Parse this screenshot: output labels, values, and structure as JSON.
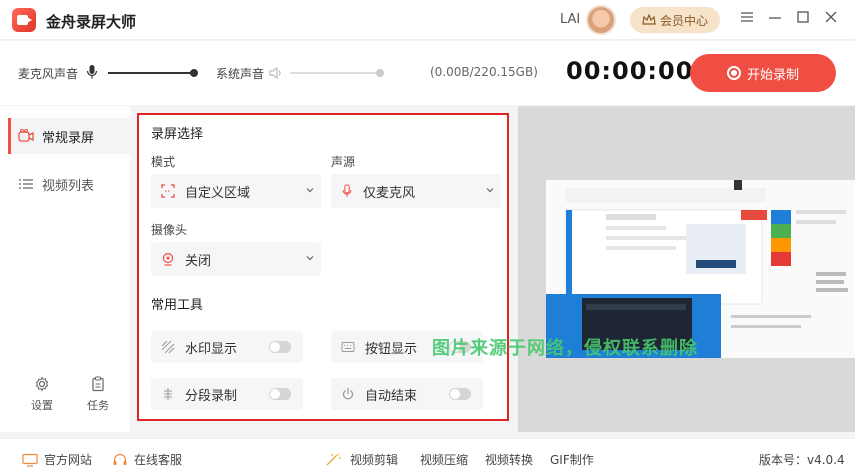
{
  "app": {
    "title": "金舟录屏大师",
    "user_name": "LAI",
    "vip_label": "会员中心"
  },
  "window_controls": [
    "menu-icon",
    "minimize-icon",
    "maximize-icon",
    "close-icon"
  ],
  "audio": {
    "mic_label": "麦克风声音",
    "mic_level": 1.0,
    "system_label": "系统声音",
    "system_level": 1.0,
    "storage": "(0.00B/220.15GB)",
    "timer": "00:00:00",
    "record_label": "开始录制"
  },
  "sidebar": {
    "items": [
      {
        "label": "常规录屏",
        "icon": "video-camera-icon",
        "active": true
      },
      {
        "label": "视频列表",
        "icon": "list-icon",
        "active": false
      }
    ],
    "bottom": [
      {
        "label": "设置",
        "icon": "gear-icon"
      },
      {
        "label": "任务",
        "icon": "clipboard-icon"
      }
    ]
  },
  "panel": {
    "title": "录屏选择",
    "mode_label": "模式",
    "mode_value": "自定义区域",
    "source_label": "声源",
    "source_value": "仅麦克风",
    "camera_label": "摄像头",
    "camera_value": "关闭",
    "tools_title": "常用工具",
    "tools": [
      {
        "label": "水印显示",
        "on": false
      },
      {
        "label": "按钮显示",
        "on": false
      },
      {
        "label": "分段录制",
        "on": false
      },
      {
        "label": "自动结束",
        "on": false
      }
    ]
  },
  "watermark": "图片来源于网络，侵权联系删除",
  "footer": {
    "website": "官方网站",
    "service": "在线客服",
    "tools": [
      "视频剪辑",
      "视频压缩",
      "视频转换",
      "GIF制作"
    ],
    "version": "版本号：v4.0.4"
  },
  "colors": {
    "accent": "#f04d43",
    "vip_bg": "#f6e3c9",
    "panel_border": "#e02424"
  }
}
